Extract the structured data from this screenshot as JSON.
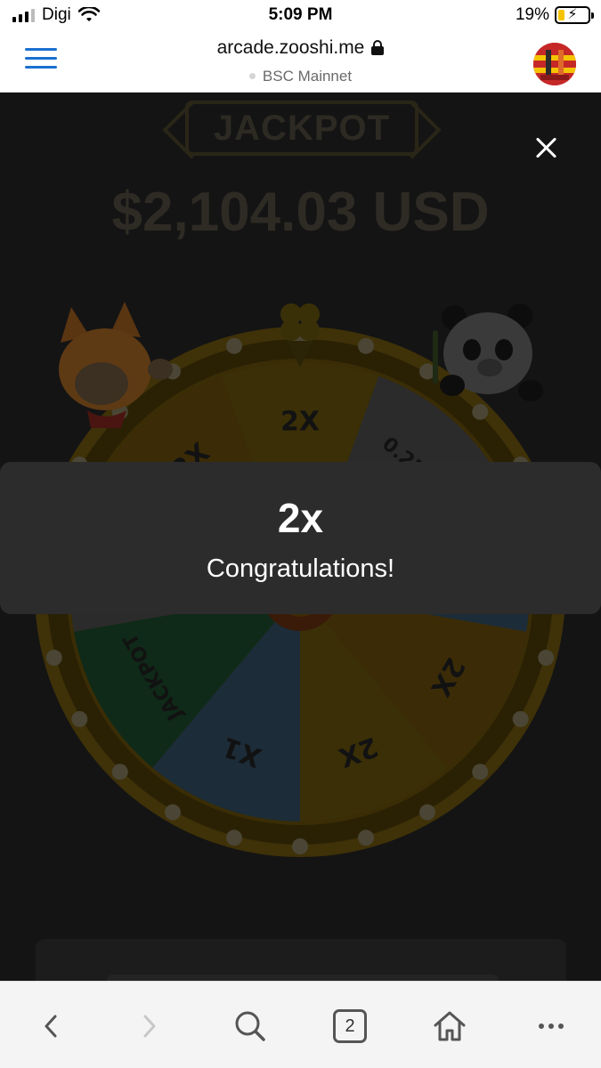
{
  "status_bar": {
    "carrier": "Digi",
    "time": "5:09 PM",
    "battery_percent": "19%",
    "battery_level": 0.19,
    "signal_bars": 3
  },
  "browser": {
    "url": "arcade.zooshi.me",
    "network": "BSC Mainnet",
    "tab_count": "2"
  },
  "game": {
    "jackpot_label": "JACKPOT",
    "jackpot_amount": "$2,104.03 USD",
    "wheel_segments": [
      "2X",
      "0.25X",
      "X1",
      "2X",
      "2X",
      "X1",
      "JACKPOT",
      "0.25X",
      "2X"
    ]
  },
  "toast": {
    "title": "2x",
    "message": "Congratulations!"
  },
  "colors": {
    "accent": "#1b6fd0",
    "toast_bg": "#2c2c2c",
    "overlay_bg": "#141414"
  },
  "icons": {
    "menu": "hamburger-icon",
    "close": "close-icon",
    "back": "chevron-left-icon",
    "forward": "chevron-right-icon",
    "search": "search-icon",
    "home": "home-icon",
    "more": "more-icon"
  }
}
